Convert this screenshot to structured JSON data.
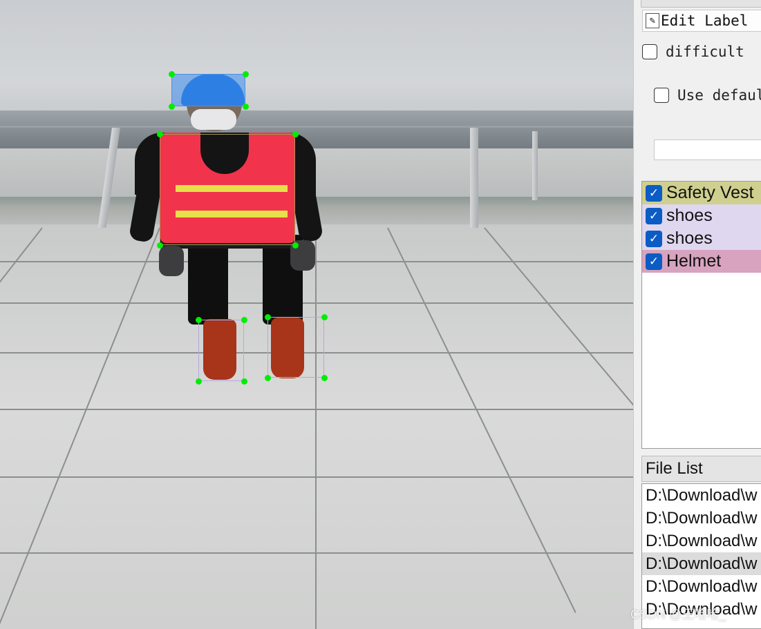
{
  "canvas": {
    "annotations": [
      {
        "label": "Helmet",
        "color": "#4a90e2"
      },
      {
        "label": "Safety Vest",
        "color": "#c7c28a"
      },
      {
        "label": "shoes",
        "color": "#b8a6e0"
      },
      {
        "label": "shoes",
        "color": "#b8a6e0"
      }
    ],
    "handle_color": "#00ee00"
  },
  "dock": {
    "edit_label_button": "Edit Label",
    "difficult_label": "difficult",
    "use_default_label": "Use defaul",
    "label_input_value": "",
    "labels": [
      {
        "name": "Safety Vest",
        "checked": true,
        "bg": "#cfd08f"
      },
      {
        "name": "shoes",
        "checked": true,
        "bg": "#dfd7ef"
      },
      {
        "name": "shoes",
        "checked": true,
        "bg": "#dfd7ef"
      },
      {
        "name": "Helmet",
        "checked": true,
        "bg": "#d7a3bf"
      }
    ],
    "file_list_title": "File List",
    "files": [
      {
        "path": "D:\\Download\\w",
        "selected": false
      },
      {
        "path": "D:\\Download\\w",
        "selected": false
      },
      {
        "path": "D:\\Download\\w",
        "selected": false
      },
      {
        "path": "D:\\Download\\w",
        "selected": true
      },
      {
        "path": "D:\\Download\\w",
        "selected": false
      },
      {
        "path": "D:\\Download\\w",
        "selected": false
      }
    ]
  },
  "watermark": "CSDN @王哈哈_"
}
